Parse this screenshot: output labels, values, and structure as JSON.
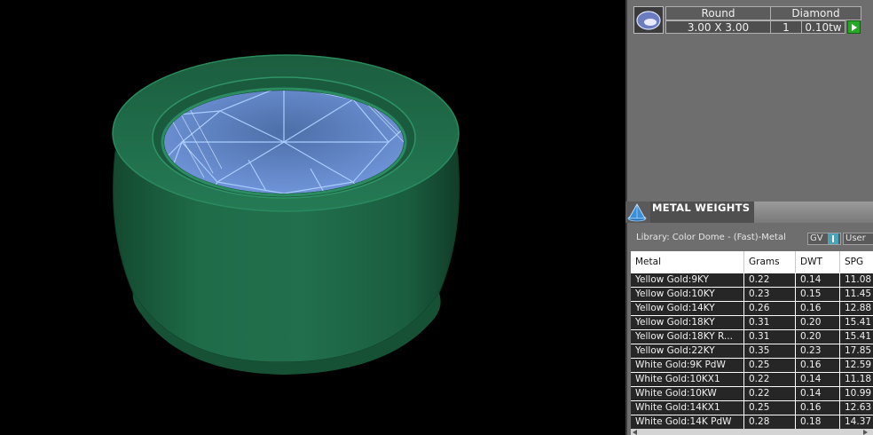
{
  "stone": {
    "shape": "Round",
    "type": "Diamond",
    "size": "3.00 X 3.00",
    "quantity": "1",
    "weight": "0.10tw",
    "thumb_icon": "round-diamond-thumbnail-icon",
    "action_icon": "play-icon"
  },
  "metal_weights": {
    "title": "METAL WEIGHTS",
    "icon": "metal-cone-icon",
    "library": "Library: Color Dome - (Fast)-Metal",
    "gv_label": "GV",
    "user_label": "User",
    "columns": [
      "Metal",
      "Grams",
      "DWT",
      "SPG"
    ],
    "rows": [
      [
        "Yellow Gold:9KY",
        "0.22",
        "0.14",
        "11.08"
      ],
      [
        "Yellow Gold:10KY",
        "0.23",
        "0.15",
        "11.45"
      ],
      [
        "Yellow Gold:14KY",
        "0.26",
        "0.16",
        "12.88"
      ],
      [
        "Yellow Gold:18KY",
        "0.31",
        "0.20",
        "15.41"
      ],
      [
        "Yellow Gold:18KY R...",
        "0.31",
        "0.20",
        "15.41"
      ],
      [
        "Yellow Gold:22KY",
        "0.35",
        "0.23",
        "17.85"
      ],
      [
        "White Gold:9K PdW",
        "0.25",
        "0.16",
        "12.59"
      ],
      [
        "White Gold:10KX1",
        "0.22",
        "0.14",
        "11.18"
      ],
      [
        "White Gold:10KW",
        "0.22",
        "0.14",
        "10.99"
      ],
      [
        "White Gold:14KX1",
        "0.25",
        "0.16",
        "12.63"
      ],
      [
        "White Gold:14K PdW",
        "0.28",
        "0.18",
        "14.37"
      ]
    ]
  },
  "colors": {
    "ring_green": "#1f6b4a",
    "gem_blue": "#9fc4ff",
    "panel_bg": "#6e6e6e"
  }
}
